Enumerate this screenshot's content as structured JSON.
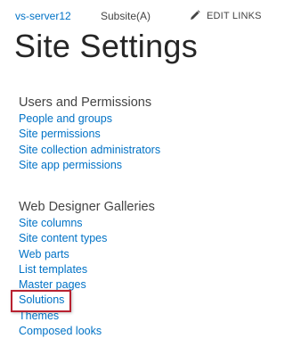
{
  "breadcrumb": {
    "site": "vs-server12",
    "subsite": "Subsite(A)",
    "edit_links": "EDIT LINKS"
  },
  "page": {
    "title": "Site Settings"
  },
  "sections": {
    "users": {
      "heading": "Users and Permissions",
      "links": [
        "People and groups",
        "Site permissions",
        "Site collection administrators",
        "Site app permissions"
      ]
    },
    "galleries": {
      "heading": "Web Designer Galleries",
      "links": [
        "Site columns",
        "Site content types",
        "Web parts",
        "List templates",
        "Master pages",
        "Solutions",
        "Themes",
        "Composed looks"
      ]
    }
  },
  "colors": {
    "link": "#0072c6",
    "text": "#444444",
    "title": "#262626",
    "highlight": "#b82130"
  },
  "highlighted_item": "Solutions"
}
